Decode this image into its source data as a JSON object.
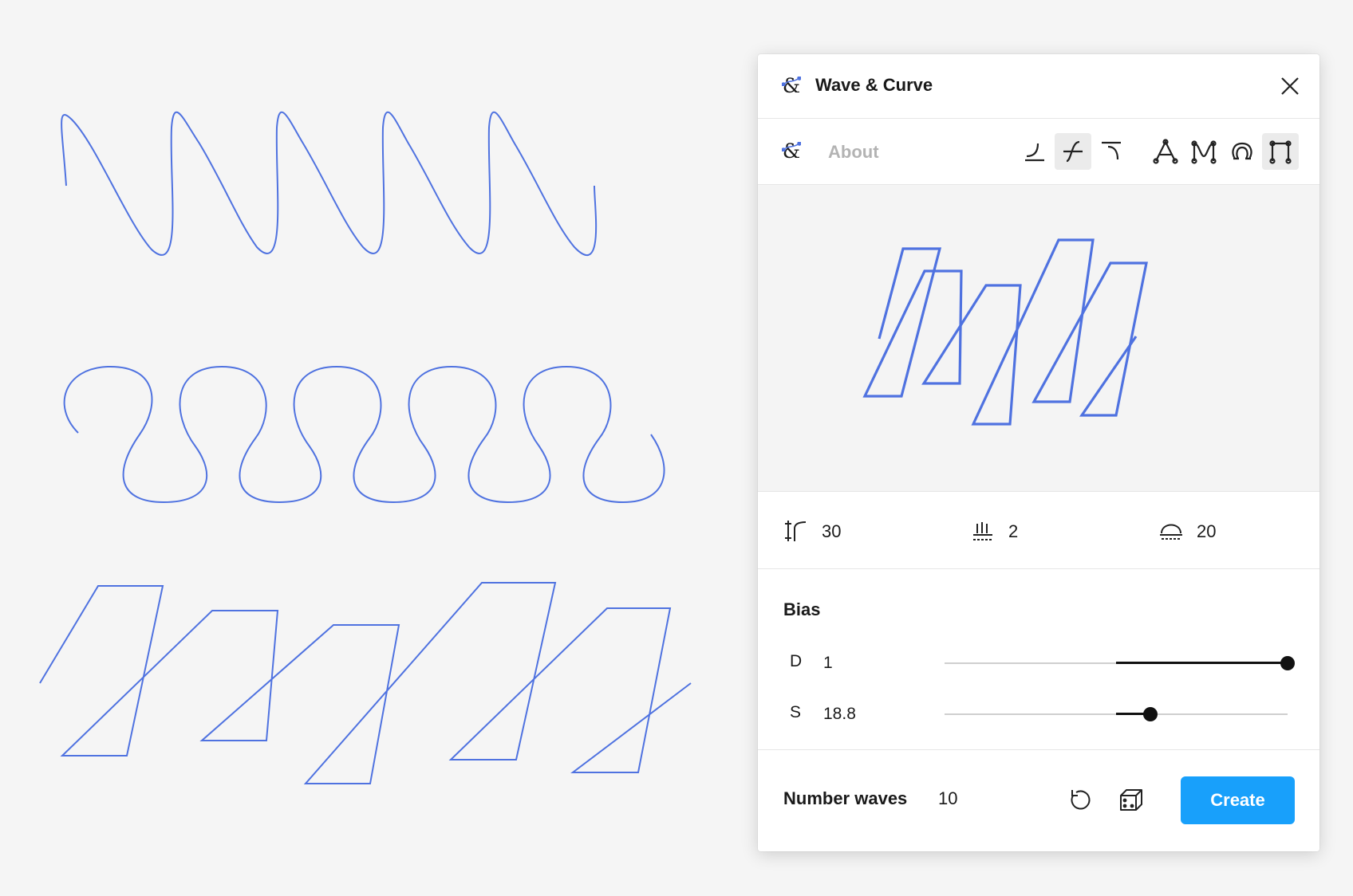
{
  "colors": {
    "accent": "#18a0fb",
    "curve": "#4f72e0",
    "panel_bg": "#ffffff",
    "canvas_bg": "#f5f5f5"
  },
  "header": {
    "logo_icon": "ampersand-curve-logo-icon",
    "title": "Wave & Curve",
    "close_icon": "close-icon"
  },
  "toolbar": {
    "about_label": "About",
    "tools": [
      {
        "name": "curve-start-icon",
        "active": false
      },
      {
        "name": "curve-wave-icon",
        "active": true
      },
      {
        "name": "curve-end-icon",
        "active": false
      },
      {
        "name": "peak-path-icon",
        "active": false
      },
      {
        "name": "double-peak-path-icon",
        "active": false
      },
      {
        "name": "loop-path-icon",
        "active": false
      },
      {
        "name": "square-path-icon",
        "active": true
      }
    ]
  },
  "params": [
    {
      "icon": "amplitude-icon",
      "value": "30"
    },
    {
      "icon": "frequency-icon",
      "value": "2"
    },
    {
      "icon": "arc-height-icon",
      "value": "20"
    }
  ],
  "bias": {
    "title": "Bias",
    "rows": [
      {
        "label": "D",
        "value": "1",
        "level": 1.0
      },
      {
        "label": "S",
        "value": "18.8",
        "level": 0.6
      }
    ]
  },
  "footer": {
    "number_waves_label": "Number waves",
    "number_waves_value": "10",
    "reset_icon": "reset-icon",
    "random_icon": "dice-icon",
    "create_label": "Create"
  }
}
